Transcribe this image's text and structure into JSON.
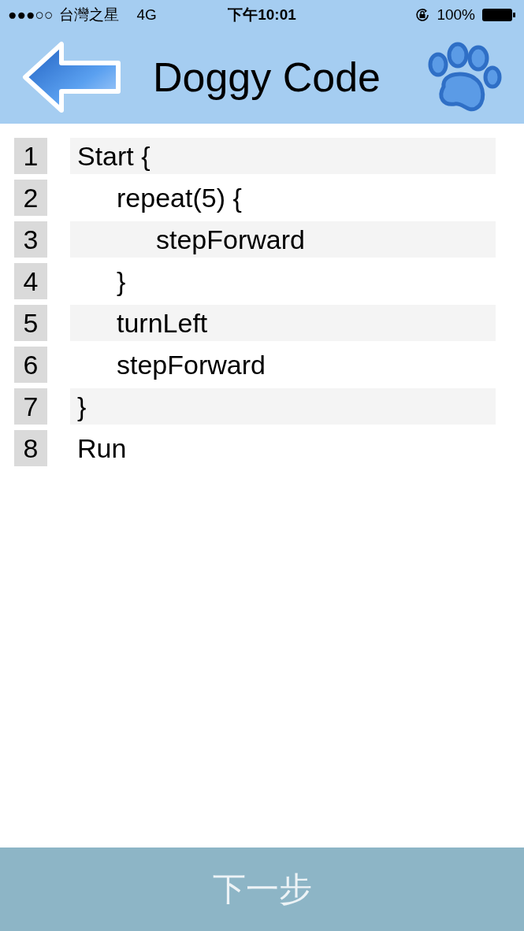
{
  "status_bar": {
    "signal": "●●●○○",
    "carrier": "台灣之星",
    "network": "4G",
    "time": "下午10:01",
    "battery": "100%"
  },
  "header": {
    "title": "Doggy Code"
  },
  "code_lines": [
    {
      "number": "1",
      "text": "Start {",
      "children": [
        {
          "number": "2",
          "text": "repeat(5) {",
          "children": [
            {
              "number": "3",
              "text": "stepForward"
            }
          ]
        },
        {
          "number": "4",
          "text": "}"
        },
        {
          "number": "5",
          "text": "turnLeft"
        },
        {
          "number": "6",
          "text": "stepForward"
        }
      ]
    },
    {
      "number": "7",
      "text": "}"
    },
    {
      "number": "8",
      "text": "Run"
    }
  ],
  "next_button": {
    "label": "下一步"
  }
}
